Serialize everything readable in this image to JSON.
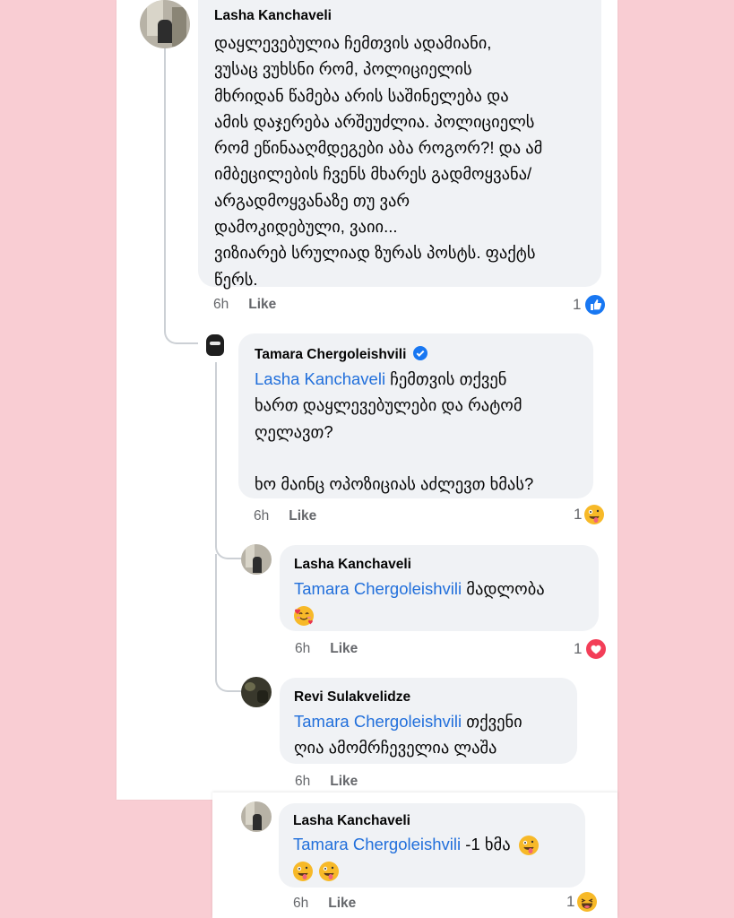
{
  "thread": {
    "c1": {
      "author": "Lasha Kanchaveli",
      "lines": [
        "დაყლევებულია ჩემთვის ადამიანი,",
        "ვუსაც ვუხსნი რომ, პოლიციელის",
        "მხრიდან წამება არის საშინელება და",
        "ამის დაჯერება არშეუძლია. პოლიციელს",
        "რომ ეწინააღმდეგები აბა როგორ?! და ამ",
        "იმბეცილების ჩვენს მხარეს გადმოყვანა/",
        "არგადმოყვანაზე თუ ვარ",
        "დამოკიდებული, ვაიი...",
        "ვიზიარებ სრულიად ზურას პოსტს. ფაქტს",
        "წერს."
      ],
      "time": "6h",
      "like_label": "Like",
      "reaction_count": "1",
      "reaction_icon": "like-icon"
    },
    "c2": {
      "author": "Tamara Chergoleishvili",
      "verified_icon": "verified-badge-icon",
      "mention": "Lasha Kanchaveli",
      "line1_rest": " ჩემთვის თქვენ",
      "line2": "ხართ დაყლევებულები და რატომ",
      "line3": "ღელავთ?",
      "line4": "ხო მაინც ოპოზიციას აძლევთ ხმას?",
      "time": "6h",
      "like_label": "Like",
      "reaction_count": "1",
      "reaction_icon": "zany-face-icon"
    },
    "c3": {
      "author": "Lasha Kanchaveli",
      "mention": "Tamara Chergoleishvili",
      "text": " მადლობა",
      "emoji": "smiling-face-with-hearts-icon",
      "time": "6h",
      "like_label": "Like",
      "reaction_count": "1",
      "reaction_icon": "love-heart-icon"
    },
    "c4": {
      "author": "Revi Sulakvelidze",
      "mention": "Tamara Chergoleishvili",
      "text1": " თქვენი",
      "line2": "ღია ამომრჩეველია ლაშა",
      "time": "6h",
      "like_label": "Like"
    },
    "c5": {
      "author": "Lasha Kanchaveli",
      "mention": "Tamara Chergoleishvili",
      "text": " -1 ხმა",
      "emoji": "zany-face-icon",
      "time": "6h",
      "like_label": "Like",
      "reaction_count": "1",
      "reaction_icon": "haha-face-icon"
    }
  },
  "colors": {
    "background": "#f9cdd3",
    "bubble": "#f0f2f5",
    "mention": "#216fdb",
    "meta": "#65676b",
    "like_blue": "#1877f2",
    "love_red": "#f33e58",
    "emoji_yellow": "#f7b928"
  }
}
